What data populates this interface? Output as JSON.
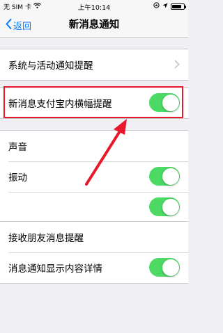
{
  "status_bar": {
    "carrier": "无 SIM 卡",
    "time": "上午10:14",
    "wifi_icon": "wifi-icon",
    "lock_icon": "rotation-lock-icon",
    "location_icon": "location-icon"
  },
  "nav": {
    "back_label": "返回",
    "title": "新消息通知"
  },
  "group1": {
    "items": [
      {
        "label": "系统与活动通知提醒"
      }
    ]
  },
  "group2": {
    "items": [
      {
        "label": "新消息支付宝内横幅提醒",
        "on": true
      }
    ]
  },
  "group3": {
    "items": [
      {
        "label": "声音"
      },
      {
        "label": "振动",
        "on": true
      },
      {
        "label": "",
        "on": true
      }
    ]
  },
  "group4": {
    "items": [
      {
        "label": "接收朋友消息提醒"
      },
      {
        "label": "消息通知显示内容详情",
        "on": true
      }
    ]
  },
  "colors": {
    "accent": "#007aff",
    "toggle_on": "#4cd964",
    "highlight": "#e8182b"
  }
}
